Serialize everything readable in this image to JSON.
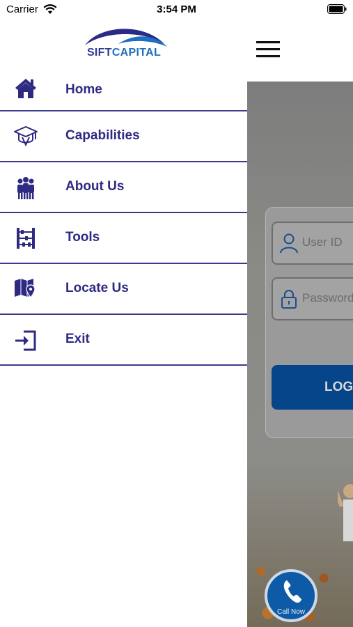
{
  "status_bar": {
    "carrier": "Carrier",
    "time": "3:54 PM"
  },
  "header": {
    "logo_left": "SIFT",
    "logo_right": "CAPITAL"
  },
  "drawer": {
    "items": [
      {
        "label": "Home",
        "icon": "home-icon"
      },
      {
        "label": "Capabilities",
        "icon": "graduation-cap-icon"
      },
      {
        "label": "About Us",
        "icon": "team-icon"
      },
      {
        "label": "Tools",
        "icon": "abacus-icon"
      },
      {
        "label": "Locate Us",
        "icon": "map-pin-icon"
      },
      {
        "label": "Exit",
        "icon": "exit-icon"
      }
    ]
  },
  "login": {
    "user_placeholder": "User ID",
    "password_placeholder": "Password",
    "login_button": "LOG"
  },
  "call_button": {
    "label": "Call Now"
  },
  "colors": {
    "brand_blue": "#2e2a82",
    "accent_blue": "#1e6fbf",
    "login_button": "#06458a"
  }
}
